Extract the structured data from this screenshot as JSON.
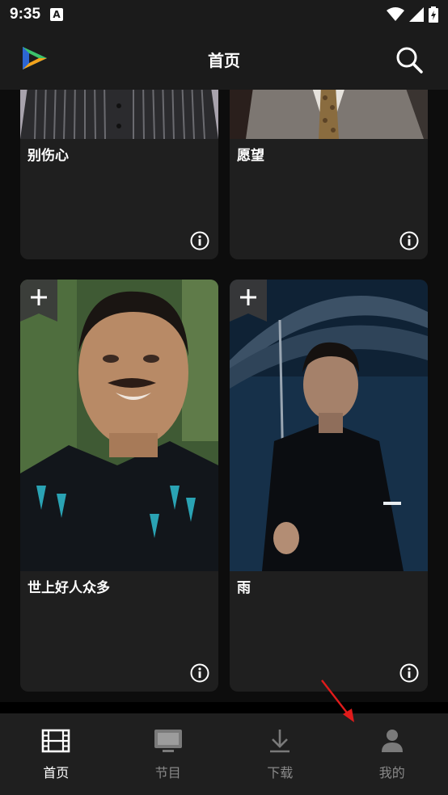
{
  "status_bar": {
    "time": "9:35",
    "notification_letter": "A"
  },
  "header": {
    "title": "首页"
  },
  "cards": [
    {
      "title": "别伤心"
    },
    {
      "title": "愿望"
    },
    {
      "title": "世上好人众多"
    },
    {
      "title": "雨"
    }
  ],
  "bottom_nav": [
    {
      "label": "首页",
      "icon": "film-icon",
      "active": true
    },
    {
      "label": "节目",
      "icon": "tv-icon",
      "active": false
    },
    {
      "label": "下载",
      "icon": "download-icon",
      "active": false
    },
    {
      "label": "我的",
      "icon": "person-icon",
      "active": false
    }
  ],
  "colors": {
    "background": "#0d0d0d",
    "card": "#1f1f1f",
    "bar": "#1b1b1b",
    "arrow": "#e01b1b"
  }
}
